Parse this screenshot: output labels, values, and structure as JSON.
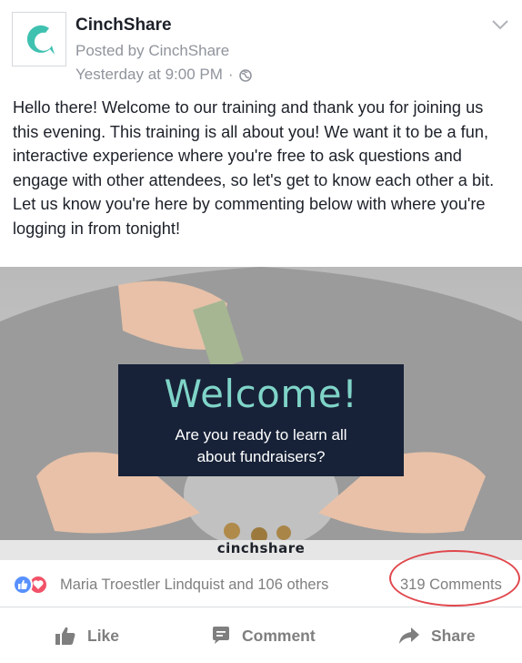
{
  "post": {
    "page_name": "CinchShare",
    "posted_by": "Posted by CinchShare",
    "timestamp": "Yesterday at 9:00 PM",
    "separator": "·",
    "text_lines": [
      "Hello there! Welcome to our training and thank you for joining us this evening. This training is all about you! We want it to be a fun, interactive experience where you're free to ask questions and engage with other attendees, so let's get to know each other a bit.",
      "Let us know you're here by commenting below with where you're logging in from tonight!"
    ]
  },
  "image": {
    "title": "Welcome!",
    "subtitle_line1": "Are you ready to learn all",
    "subtitle_line2": "about fundraisers?",
    "brand": "cinchshare"
  },
  "engagement": {
    "reactions_text": "Maria Troestler Lindquist and 106 others",
    "comments_text": "319 Comments",
    "reaction_types": [
      "like",
      "love"
    ]
  },
  "actions": {
    "like_label": "Like",
    "comment_label": "Comment",
    "share_label": "Share"
  },
  "colors": {
    "brand_teal": "#3fc1b0",
    "like_blue": "#5890ff",
    "love_red": "#f25268",
    "highlight_ring": "#e0474c",
    "image_panel": "#172238"
  },
  "icons": [
    "cinchshare-logo-icon",
    "globe-icon",
    "chevron-down-icon",
    "like-reaction-icon",
    "love-reaction-icon",
    "thumbs-up-icon",
    "comment-icon",
    "share-arrow-icon"
  ]
}
